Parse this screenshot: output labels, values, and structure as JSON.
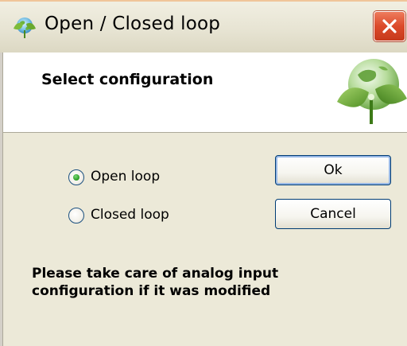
{
  "window": {
    "title": "Open / Closed loop",
    "close_label": "Close"
  },
  "header": {
    "title": "Select configuration"
  },
  "options": {
    "items": [
      {
        "label": "Open loop",
        "selected": true
      },
      {
        "label": "Closed loop",
        "selected": false
      }
    ]
  },
  "buttons": {
    "ok_label": "Ok",
    "cancel_label": "Cancel"
  },
  "message": {
    "line1": "Please take care of analog input",
    "line2": "configuration if it was modified"
  },
  "colors": {
    "close_button": "#dc4a2a",
    "radio_selected": "#31a52b",
    "button_border": "#003c74",
    "dialog_bg": "#ece9d8"
  },
  "icons": {
    "app_icon": "leaf-globe-icon",
    "close_icon": "close-icon",
    "logo": "globe-leaves-logo"
  }
}
